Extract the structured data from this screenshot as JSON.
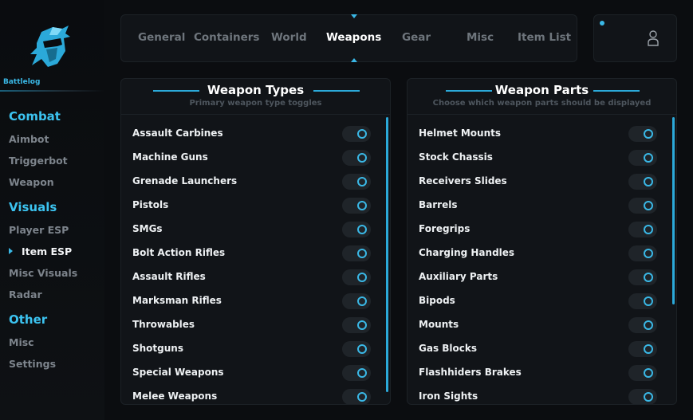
{
  "brand": {
    "name": "Battlelog",
    "logo_icon": "knight-helmet-icon"
  },
  "sidebar": {
    "sections": [
      {
        "label": "Combat",
        "items": [
          "Aimbot",
          "Triggerbot",
          "Weapon"
        ]
      },
      {
        "label": "Visuals",
        "items": [
          "Player ESP",
          "Item ESP",
          "Misc Visuals",
          "Radar"
        ]
      },
      {
        "label": "Other",
        "items": [
          "Misc",
          "Settings"
        ]
      }
    ],
    "active_item": "Item ESP"
  },
  "tabs": {
    "items": [
      "General",
      "Containers",
      "World",
      "Weapons",
      "Gear",
      "Misc",
      "Item List"
    ],
    "active": "Weapons"
  },
  "user": {
    "icon": "user-icon"
  },
  "panels": {
    "weapon_types": {
      "title": "Weapon Types",
      "subtitle": "Primary weapon type toggles",
      "items": [
        "Assault Carbines",
        "Machine Guns",
        "Grenade Launchers",
        "Pistols",
        "SMGs",
        "Bolt Action Rifles",
        "Assault Rifles",
        "Marksman Rifles",
        "Throwables",
        "Shotguns",
        "Special Weapons",
        "Melee Weapons"
      ]
    },
    "weapon_parts": {
      "title": "Weapon Parts",
      "subtitle": "Choose which weapon parts should be displayed",
      "items": [
        "Helmet Mounts",
        "Stock Chassis",
        "Receivers Slides",
        "Barrels",
        "Foregrips",
        "Charging Handles",
        "Auxiliary Parts",
        "Bipods",
        "Mounts",
        "Gas Blocks",
        "Flashhiders Brakes",
        "Iron Sights"
      ]
    }
  },
  "colors": {
    "accent": "#3ab8e6",
    "section": "#3cc3f0",
    "muted": "#7d848c",
    "panel": "#111418"
  }
}
